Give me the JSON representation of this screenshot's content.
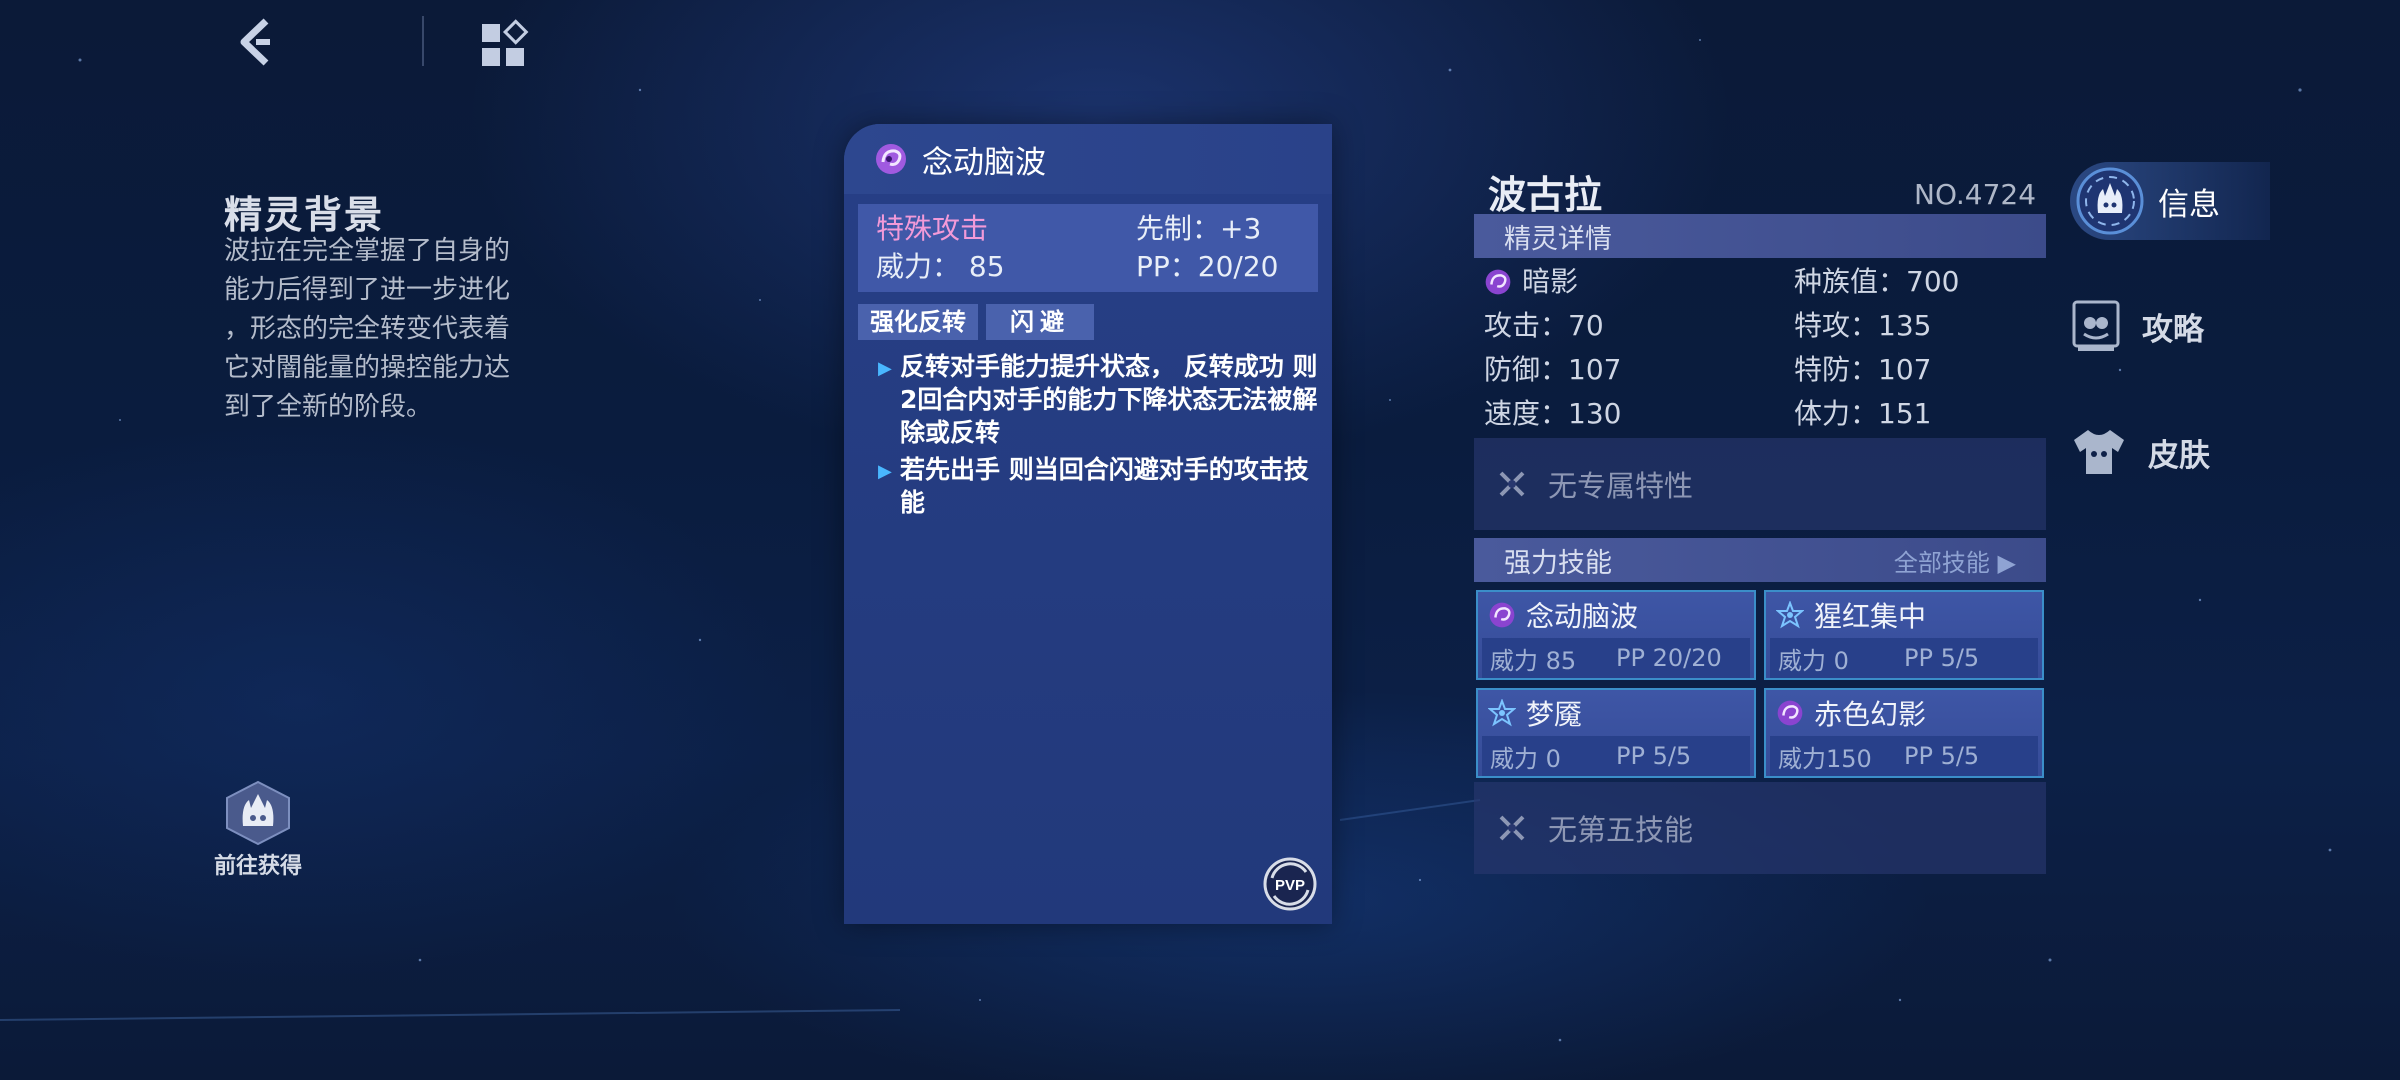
{
  "topbar": {
    "back_icon": "back-arrow-icon",
    "menu_icon": "grid-menu-icon"
  },
  "lore": {
    "title": "精灵背景",
    "lines": [
      "波拉在完全掌握了自身的",
      "能力后得到了进一步进化",
      "，形态的完全转变代表着",
      "它对闇能量的操控能力达",
      "到了全新的阶段。"
    ],
    "obtain_label": "前往获得"
  },
  "skill_card": {
    "name": "念动脑波",
    "category": "特殊攻击",
    "priority_label": "先制：+3",
    "power_label": "威力：",
    "power_value": "85",
    "pp_label": "PP：20/20",
    "tags": [
      "强化反转",
      "闪避"
    ],
    "effects": [
      [
        "反转对手能力提升状态，",
        "反转成功",
        "则2回合内对手的能力下降状态无法被解除或反转"
      ],
      [
        "若先出手",
        "则当回合闪避对手的攻击技能"
      ]
    ],
    "pvp_label": "PVP"
  },
  "pet": {
    "name": "波古拉",
    "number": "NO.4724",
    "detail_header": "精灵详情",
    "attribute": "暗影",
    "stats": {
      "race_value": "种族值：700",
      "attack": "攻击：70",
      "sp_attack": "特攻：135",
      "defense": "防御：107",
      "sp_defense": "特防：107",
      "speed": "速度：130",
      "hp": "体力：151"
    },
    "trait": "无专属特性",
    "skills_header": "强力技能",
    "all_skills": "全部技能",
    "moves": [
      {
        "name": "念动脑波",
        "power": "威力 85",
        "pp": "PP 20/20",
        "icon": "shadow-swirl-icon"
      },
      {
        "name": "猩红集中",
        "power": "威力 0",
        "pp": "PP 5/5",
        "icon": "star-buff-icon"
      },
      {
        "name": "梦魇",
        "power": "威力 0",
        "pp": "PP 5/5",
        "icon": "star-buff-icon"
      },
      {
        "name": "赤色幻影",
        "power": "威力150",
        "pp": "PP 5/5",
        "icon": "shadow-swirl-icon"
      }
    ],
    "fifth_skill": "无第五技能"
  },
  "side_tabs": {
    "info": "信息",
    "guide": "攻略",
    "skin": "皮肤"
  },
  "colors": {
    "card_bg": "#273f86",
    "category_pink": "#f29ad8",
    "move_border": "#3b8ec9",
    "shadow_purple": "#a05ae0"
  }
}
